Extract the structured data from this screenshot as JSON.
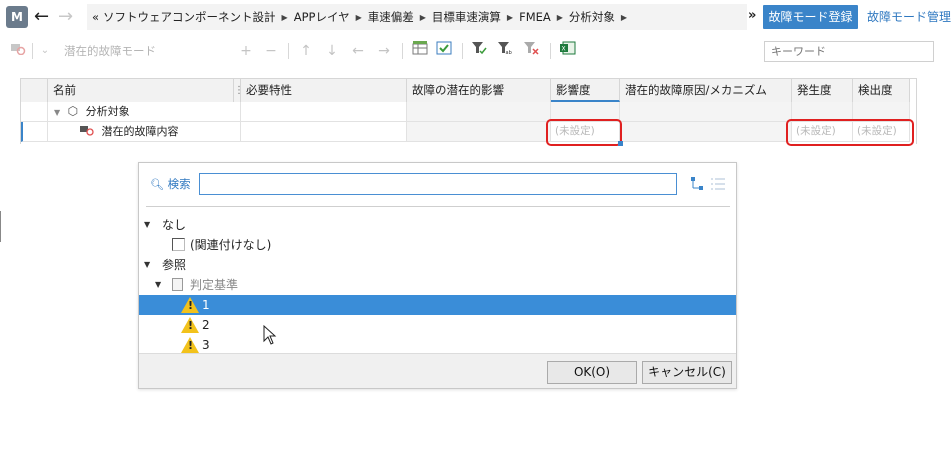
{
  "app": {
    "icon_letter": "M"
  },
  "breadcrumb": {
    "overflow": "«",
    "items": [
      "ソフトウェアコンポーネント設計",
      "APPレイヤ",
      "車速偏差",
      "目標車速演算",
      "FMEA",
      "分析対象"
    ]
  },
  "header_actions": {
    "more": "»",
    "register": "故障モード登録",
    "manage": "故障モード管理"
  },
  "toolbar": {
    "mode_label": "潜在的故障モード",
    "keyword_placeholder": "キーワード"
  },
  "grid": {
    "columns": [
      "名前",
      "必要特性",
      "故障の潜在的影響",
      "影響度",
      "潜在的故障原因/メカニズム",
      "発生度",
      "検出度"
    ],
    "rows": [
      {
        "name": "分析対象",
        "cells": [
          "",
          "",
          "",
          "",
          "",
          ""
        ]
      },
      {
        "name": "潜在的故障内容",
        "cells": [
          "",
          "",
          "(未設定)",
          "",
          "(未設定)",
          "(未設定)"
        ]
      }
    ]
  },
  "popup": {
    "search_label": "検索",
    "search_value": "",
    "tree": [
      {
        "label": "なし"
      },
      {
        "label": "(関連付けなし)"
      },
      {
        "label": "参照"
      },
      {
        "label": "判定基準"
      },
      {
        "label": "1"
      },
      {
        "label": "2"
      },
      {
        "label": "3"
      }
    ],
    "ok": "OK(O)",
    "cancel": "キャンセル(C)"
  },
  "colors": {
    "accent": "#3a84c9",
    "selection": "#3a8dd8",
    "highlight_box": "#e02020",
    "warning": "#f2c21b"
  }
}
